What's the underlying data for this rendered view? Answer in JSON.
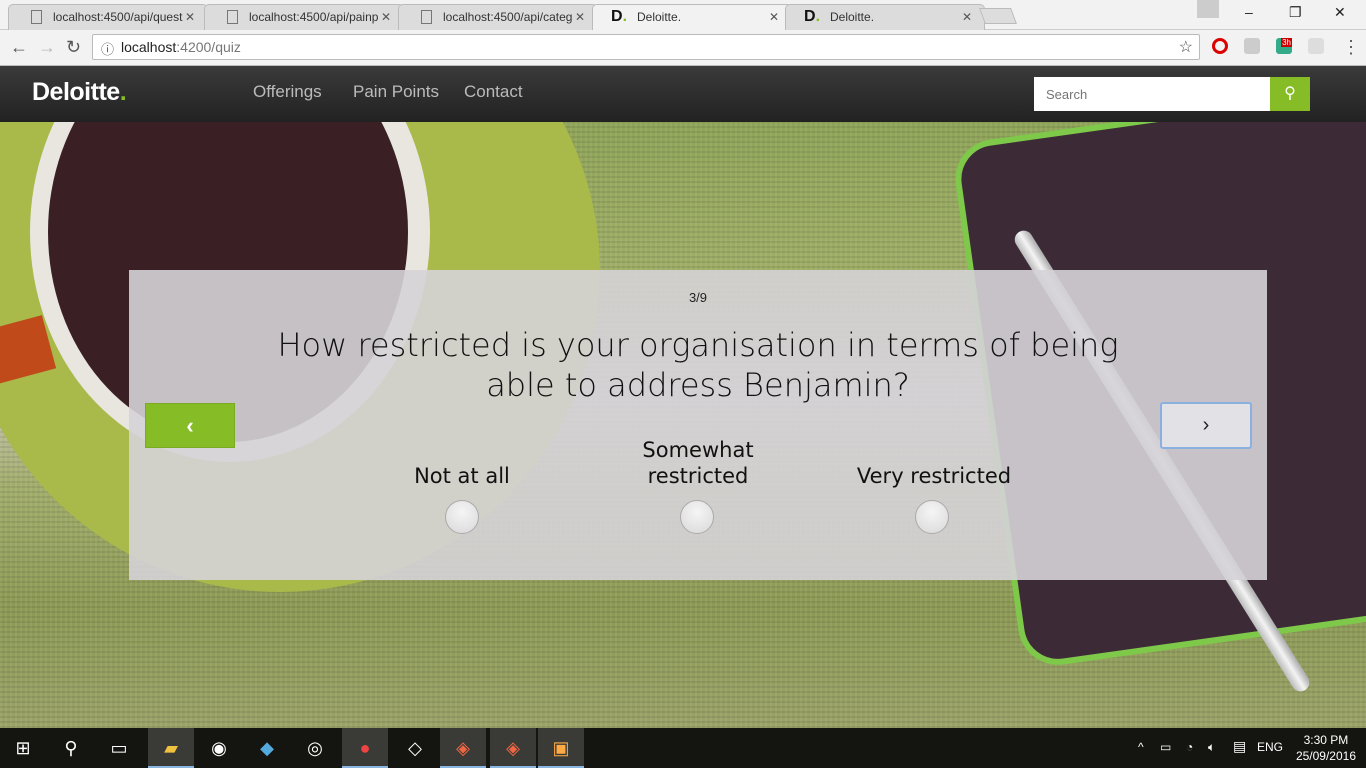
{
  "browser": {
    "tabs": [
      {
        "title": "localhost:4500/api/quest",
        "icon": "page-icon"
      },
      {
        "title": "localhost:4500/api/painp",
        "icon": "page-icon"
      },
      {
        "title": "localhost:4500/api/categ",
        "icon": "page-icon"
      },
      {
        "title": "Deloitte.",
        "icon": "deloitte-favicon",
        "active": true
      },
      {
        "title": "Deloitte.",
        "icon": "deloitte-favicon"
      }
    ],
    "close_glyph": "✕",
    "url_host": "localhost",
    "url_rest": ":4200/quiz",
    "extension_badge": "3h"
  },
  "navbar": {
    "logo": "Deloitte",
    "logo_dot": ".",
    "links": [
      "Offerings",
      "Pain Points",
      "Contact"
    ],
    "search_placeholder": "Search",
    "accent": "#86bc25"
  },
  "quiz": {
    "progress": "3/9",
    "question": "How restricted is your organisation in terms of being able to address Benjamin?",
    "options": [
      "Not at all",
      "Somewhat restricted",
      "Very restricted"
    ],
    "prev_glyph": "‹",
    "next_glyph": "›"
  },
  "taskbar": {
    "language": "ENG",
    "time": "3:30 PM",
    "date": "25/09/2016"
  }
}
